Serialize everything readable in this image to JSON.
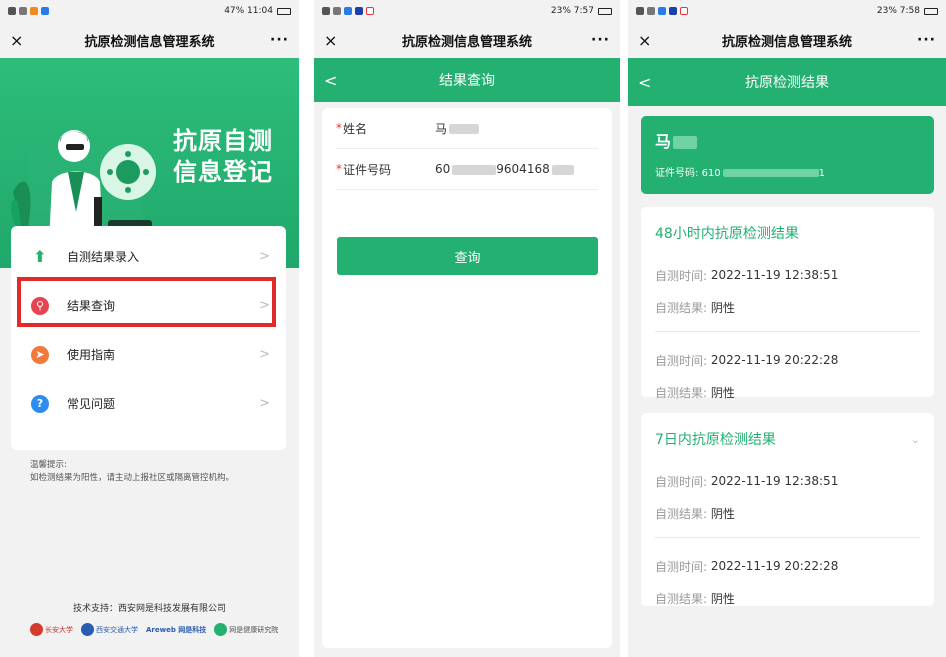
{
  "status": {
    "p1_right": "47% 11:04",
    "p2_right": "23% 7:57",
    "p3_right": "23% 7:58"
  },
  "app_title": "抗原检测信息管理系统",
  "close_glyph": "×",
  "more_glyph": "···",
  "back_glyph": "<",
  "chevron_glyph": ">",
  "home": {
    "hero_title_line1": "抗原自测",
    "hero_title_line2": "信息登记",
    "menu": [
      {
        "label": "自测结果录入",
        "icon": "upload-arrow-icon",
        "color": "#23b071"
      },
      {
        "label": "结果查询",
        "icon": "search-icon",
        "color": "#e8444f"
      },
      {
        "label": "使用指南",
        "icon": "compass-icon",
        "color": "#f07a3c"
      },
      {
        "label": "常见问题",
        "icon": "question-icon",
        "color": "#2d8ef0"
      }
    ],
    "tips_line1": "温馨提示:",
    "tips_line2": "如检测结果为阳性，请主动上报社区或隔离管控机构。",
    "support": "技术支持：西安网是科技发展有限公司",
    "logos": [
      "长安大学",
      "西安交通大学",
      "Areweb 网是科技",
      "网是健康研究院"
    ]
  },
  "query": {
    "header": "结果查询",
    "name_label": "姓名",
    "name_value": "马",
    "id_label": "证件号码",
    "id_prefix": "60",
    "id_mid": "9604168",
    "required_mark": "*",
    "button": "查询"
  },
  "results": {
    "header": "抗原检测结果",
    "name": "马",
    "id_label": "证件号码:",
    "id_prefix": "610",
    "id_suffix": "1",
    "section1_title": "48小时内抗原检测结果",
    "section2_title": "7日内抗原检测结果",
    "time_label": "自测时间:",
    "result_label": "自测结果:",
    "records": [
      {
        "time": "2022-11-19 12:38:51",
        "result": "阴性"
      },
      {
        "time": "2022-11-19 20:22:28",
        "result": "阴性"
      }
    ],
    "records_7d": [
      {
        "time": "2022-11-19 12:38:51",
        "result": "阴性"
      },
      {
        "time": "2022-11-19 20:22:28",
        "result": "阴性"
      }
    ]
  },
  "colors": {
    "brand_green": "#23b071",
    "highlight_red": "#e32a2a"
  }
}
